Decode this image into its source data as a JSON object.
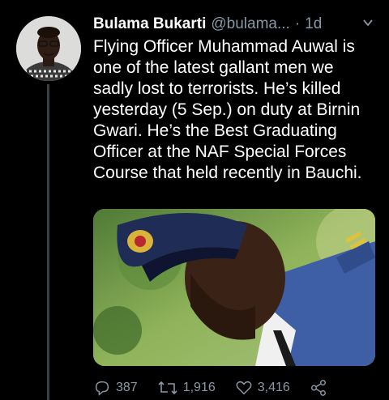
{
  "tweet": {
    "display_name": "Bulama Bukarti",
    "handle": "@bulama...",
    "separator": "·",
    "time": "1d",
    "text": "Flying Officer Muhammad Auwal is\none of the latest gallant men we\nsadly lost to terrorists. He’s killed\nyesterday (5 Sep.) on duty at Birnin\nGwari. He’s the Best Graduating\nOfficer at the NAF Special Forces\nCourse that held recently in Bauchi."
  },
  "actions": {
    "reply_count": "387",
    "retweet_count": "1,916",
    "like_count": "3,416"
  },
  "colors": {
    "background": "#000000",
    "secondary_text": "#8899a6",
    "thread_line": "#3a3f45"
  },
  "icons": {
    "reply": "reply-icon",
    "retweet": "retweet-icon",
    "like": "heart-icon",
    "share": "share-icon",
    "more": "chevron-down-icon"
  }
}
